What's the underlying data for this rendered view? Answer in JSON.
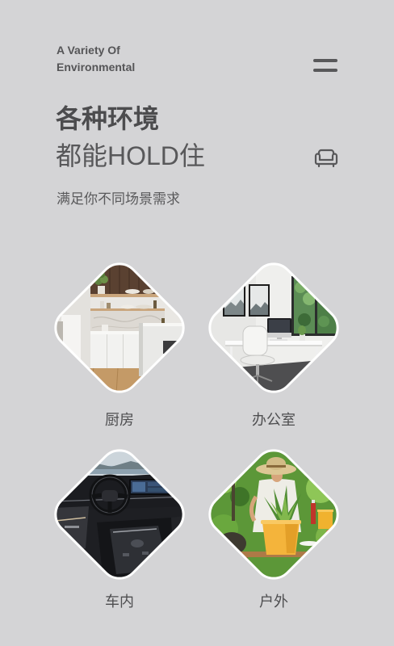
{
  "header": {
    "subtitle_line1": "A Variety Of",
    "subtitle_line2": "Environmental",
    "menu_icon": "menu-icon"
  },
  "hero": {
    "title_line1": "各种环境",
    "title_line2": "都能HOLD住",
    "sofa_icon": "sofa-icon",
    "description": "满足你不同场景需求"
  },
  "scenes": [
    {
      "label": "厨房"
    },
    {
      "label": "办公室"
    },
    {
      "label": "车内"
    },
    {
      "label": "户外"
    }
  ],
  "colors": {
    "background": "#d4d4d6",
    "text": "#505052",
    "tile_border": "#ffffff"
  }
}
